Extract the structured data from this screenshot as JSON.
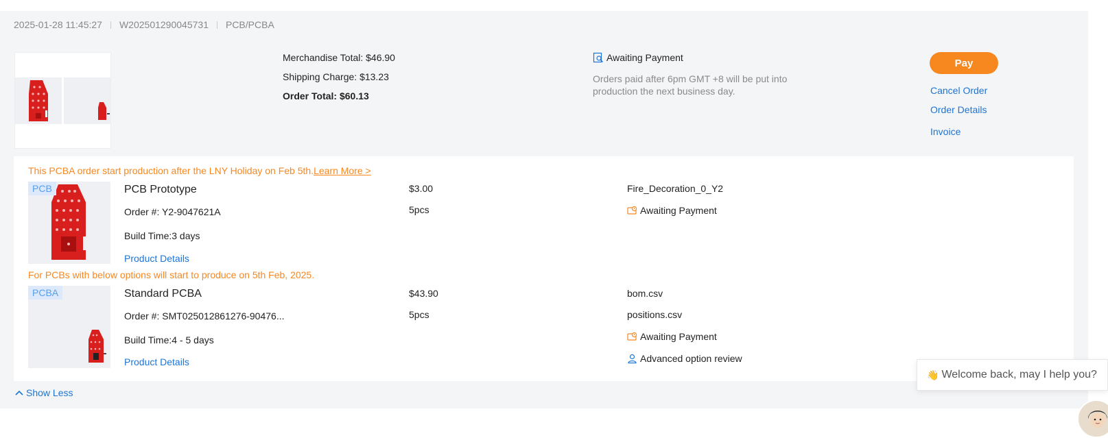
{
  "order": {
    "datetime": "2025-01-28 11:45:27",
    "number": "W202501290045731",
    "category": "PCB/PCBA"
  },
  "totals": {
    "merchandise": "Merchandise Total: $46.90",
    "shipping": "Shipping Charge: $13.23",
    "order_total": "Order Total: $60.13"
  },
  "status": {
    "label": "Awaiting Payment",
    "note": "Orders paid after 6pm GMT +8 will be put into production the next business day."
  },
  "actions": {
    "pay": "Pay",
    "cancel": "Cancel Order",
    "details": "Order Details",
    "invoice": "Invoice"
  },
  "notices": {
    "pcba_notice": "This PCBA order start production after the LNY Holiday on Feb 5th.",
    "learn_more": "Learn More >",
    "pcb_notice": "For PCBs with below options will start to produce on 5th Feb, 2025."
  },
  "items": [
    {
      "tag": "PCB",
      "title": "PCB Prototype",
      "order_no": "Order #: Y2-9047621A",
      "build_time": "Build Time:3 days",
      "details_link": "Product Details",
      "price": "$3.00",
      "qty": "5pcs",
      "file": "Fire_Decoration_0_Y2",
      "status": "Awaiting Payment"
    },
    {
      "tag": "PCBA",
      "title": "Standard PCBA",
      "order_no": "Order #: SMT025012861276-90476...",
      "build_time": "Build Time:4 - 5 days",
      "details_link": "Product Details",
      "price": "$43.90",
      "qty": "5pcs",
      "file1": "bom.csv",
      "file2": "positions.csv",
      "status": "Awaiting Payment",
      "review": "Advanced option review"
    }
  ],
  "show_less": "Show Less",
  "chat": {
    "emoji": "👋",
    "message": "Welcome back, may I help you?"
  },
  "colors": {
    "accent_orange": "#f7871f",
    "link_blue": "#1d74d4",
    "pcb_red": "#d91e1e",
    "panel_bg": "#f4f5f7"
  }
}
